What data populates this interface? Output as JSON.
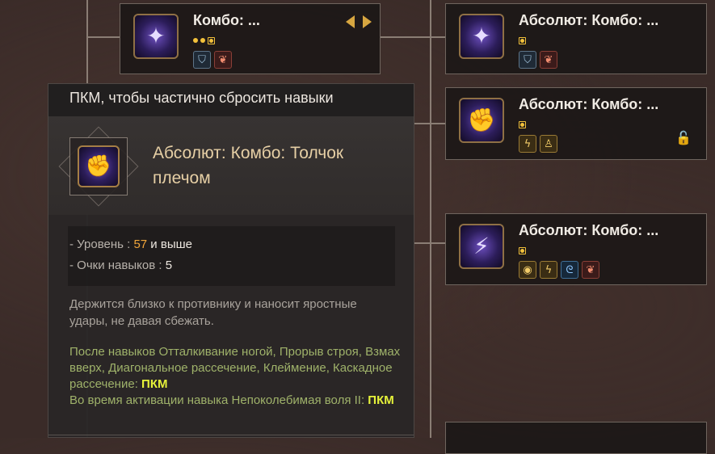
{
  "skill_cards": [
    {
      "title": "Комбо: ...",
      "dots": [
        "filled",
        "filled",
        "selected"
      ],
      "tripods": [
        {
          "icon": "shield-icon",
          "glyph": "⛉"
        },
        {
          "icon": "feather-icon",
          "glyph": "❦"
        }
      ]
    },
    {
      "title": "Абсолют: Комбо: ...",
      "dots": [
        "selected"
      ],
      "tripods": [
        {
          "icon": "shield-icon",
          "glyph": "⛉"
        },
        {
          "icon": "feather-icon",
          "glyph": "❦"
        }
      ]
    },
    {
      "title": "Абсолют: Комбо: ...",
      "dots": [
        "selected"
      ],
      "tripods": [
        {
          "icon": "lightning-icon",
          "glyph": "ϟ"
        },
        {
          "icon": "figure-icon",
          "glyph": "♙"
        }
      ]
    },
    {
      "title": "Абсолют: Комбо: ...",
      "dots": [
        "selected"
      ],
      "tripods": [
        {
          "icon": "eye-icon",
          "glyph": "◉"
        },
        {
          "icon": "lightning-icon",
          "glyph": "ϟ"
        },
        {
          "icon": "spiral-icon",
          "glyph": "ᘓ"
        },
        {
          "icon": "feather-icon",
          "glyph": "❦"
        }
      ]
    }
  ],
  "tooltip": {
    "hint": "ПКМ, чтобы частично сбросить навыки",
    "skill_name": "Абсолют: Комбо: Толчок плечом",
    "level_label": "- Уровень : ",
    "level_value": "57",
    "level_suffix": " и выше",
    "points_label": "- Очки навыков : ",
    "points_value": "5",
    "description": "Держится близко к противнику и наносит яростные удары, не давая сбежать.",
    "tripod_line1": "После навыков Отталкивание ногой, Прорыв строя, Взмах вверх, Диагональное рассечение, Клеймение, Каскадное рассечение: ",
    "tripod_key1": "ПКМ",
    "tripod_line2": "Во время активации навыка Непоколебимая воля II: ",
    "tripod_key2": "ПКМ"
  },
  "colors": {
    "accent_gold": "#f2c13b",
    "highlight": "#e6f23a",
    "level": "#f0a53a",
    "tripod_text": "#9fb26a"
  }
}
